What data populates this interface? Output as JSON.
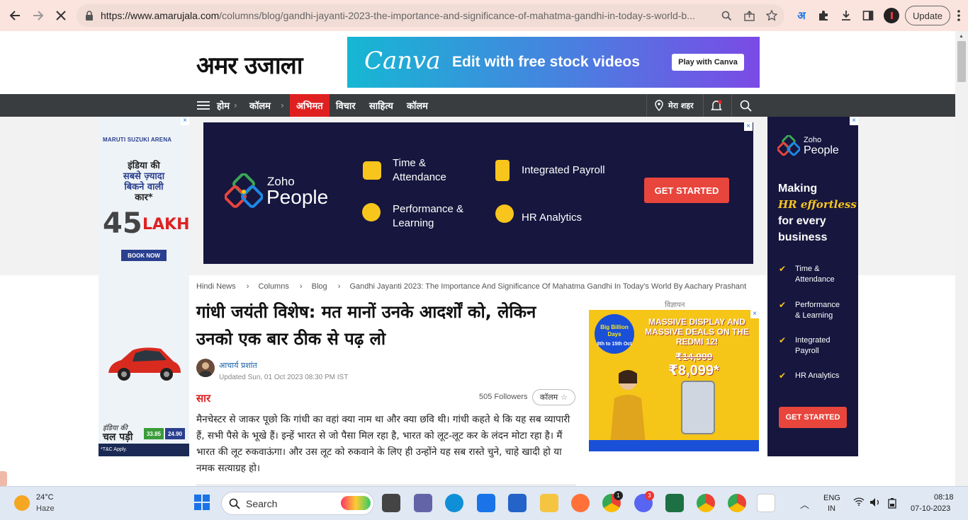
{
  "browser": {
    "url_host": "https://www.amarujala.com",
    "url_path": "/columns/blog/gandhi-jayanti-2023-the-importance-and-significance-of-mahatma-gandhi-in-today-s-world-b...",
    "update_label": "Update",
    "translate_glyph": "अ"
  },
  "site": {
    "logo": "अमर उजाला",
    "nav": {
      "home": "होम",
      "columns": "कॉलम",
      "active": "अभिमत",
      "items": [
        "विचार",
        "साहित्य",
        "कॉलम"
      ],
      "my_city": "मेरा शहर"
    }
  },
  "ads": {
    "canva": {
      "brand": "Canva",
      "text": "Edit with free stock videos",
      "button": "Play with Canva"
    },
    "zoho_center": {
      "brand_top": "Zoho",
      "brand_bottom": "People",
      "features": [
        "Time &",
        "Attendance",
        "Integrated Payroll",
        "Performance &",
        "Learning",
        "HR Analytics"
      ],
      "button": "GET STARTED"
    },
    "zoho_right": {
      "brand_top": "Zoho",
      "brand_bottom": "People",
      "line1": "Making",
      "line2": "HR effortless",
      "line3": "for every",
      "line4": "business",
      "features": [
        "Time &",
        "Attendance",
        "Performance",
        "& Learning",
        "Integrated",
        "Payroll",
        "HR Analytics"
      ],
      "button": "GET STARTED"
    },
    "maruti": {
      "brand": "MARUTI SUZUKI ARENA",
      "line1": "इंडिया की",
      "line2": "सबसे ज़्यादा",
      "line3": "बिकने वाली",
      "line4": "कार*",
      "big": "45",
      "lakh": "LAKH",
      "book": "BOOK NOW",
      "tagline1": "इंडिया की",
      "tagline2": "चल पड़ी",
      "price1": "33.85",
      "price2": "24.90",
      "tc": "*T&C Apply."
    },
    "flipkart": {
      "label": "विज्ञापन",
      "head": "MASSIVE DISPLAY AND MASSIVE DEALS ON THE REDMI 12!",
      "old_price": "₹14,999",
      "new_price": "₹8,099*",
      "event": "Big Billion Days",
      "dates": "8th to 15th Oct"
    }
  },
  "article": {
    "breadcrumb": [
      "Hindi News",
      "›",
      "Columns",
      "›",
      "Blog",
      "›",
      "Gandhi Jayanti 2023: The Importance And Significance Of Mahatma Gandhi In Today's World By Aachary Prashant"
    ],
    "headline": "गांधी जयंती विशेष: मत मानों उनके आदर्शों को, लेकिन उनको एक बार ठीक से पढ़ लो",
    "author": "आचार्य प्रशांत",
    "updated": "Updated Sun, 01 Oct 2023 08:30 PM IST",
    "saar": "सार",
    "followers": "505 Followers",
    "follow_label": "कॉलम",
    "summary": "मैनचेस्टर से जाकर पूछो कि गांधी का वहां क्या नाम था और क्या छवि थी। गांधी कहते थे कि यह सब व्यापारी हैं, सभी पैसे के भूखे हैं। इन्हें भारत से जो पैसा मिल रहा है, भारत को लूट-लूट कर के लंदन मोटा रहा है। मैं भारत की लूट रुकवाऊंगा। और उस लूट को रुकवाने के लिए ही उन्होंने यह सब रास्ते चुने, चाहे खादी हो या नमक सत्याग्रह हो।"
  },
  "taskbar": {
    "temp": "24°C",
    "weather": "Haze",
    "search": "Search",
    "lang1": "ENG",
    "lang2": "IN",
    "time": "08:18",
    "date": "07-10-2023",
    "badges": {
      "chrome": "1",
      "discord": "3"
    }
  }
}
